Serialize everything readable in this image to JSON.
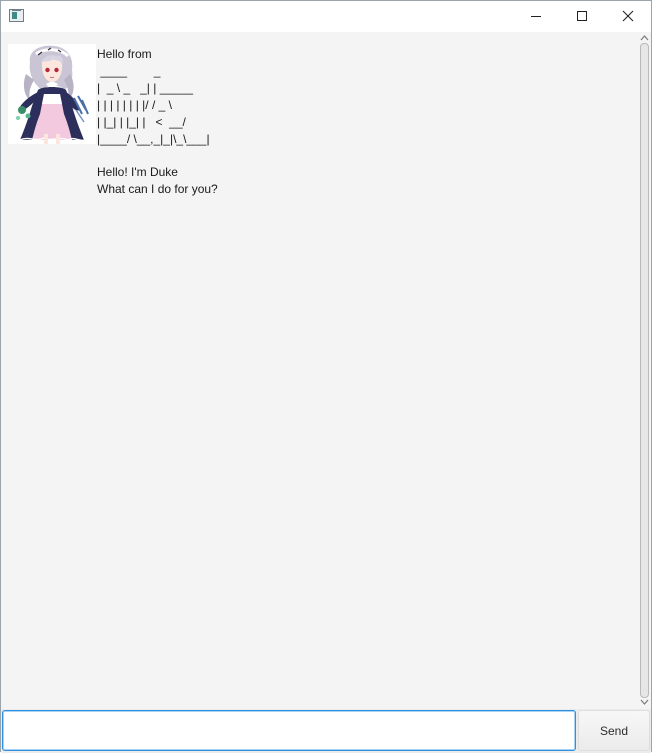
{
  "window": {
    "controls": {
      "minimize_icon": "minimize-icon",
      "maximize_icon": "maximize-icon",
      "close_icon": "close-icon"
    }
  },
  "chat": {
    "avatar": "character-avatar",
    "message": {
      "greeting": "Hello from",
      "logo_lines": [
        " ____        _        ",
        "|  _ \\ _   _| | _____ ",
        "| | | | | | | |/ / _ \\",
        "| |_| | |_| |   <  __/",
        "|____/ \\__,_|_|\\_\\___|"
      ],
      "intro": "Hello! I'm Duke",
      "prompt": "What can I do for you?"
    }
  },
  "input": {
    "value": "",
    "placeholder": ""
  },
  "send_button": {
    "label": "Send"
  },
  "colors": {
    "chat_background": "#f4f4f4",
    "input_focus_border": "#2f8fe0"
  }
}
